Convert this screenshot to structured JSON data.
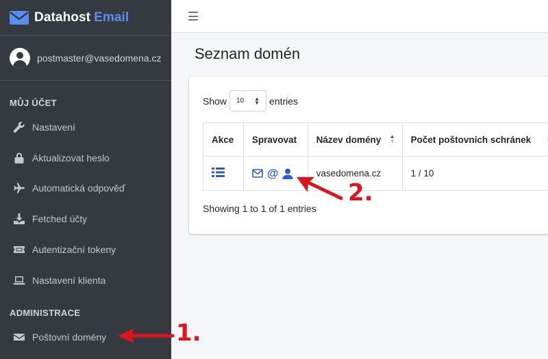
{
  "brand": {
    "name": "Datahost",
    "accent": "Email",
    "logo_icon": "envelope-icon",
    "accent_color": "#5b8def"
  },
  "user": {
    "email": "postmaster@vasedomena.cz",
    "avatar_icon": "user-circle-icon"
  },
  "sidebar": {
    "sections": [
      {
        "header": "MŮJ ÚČET",
        "items": [
          {
            "label": "Nastavení",
            "icon": "wrench-icon"
          },
          {
            "label": "Aktualizovat heslo",
            "icon": "lock-icon"
          },
          {
            "label": "Automatická odpověď",
            "icon": "plane-icon"
          },
          {
            "label": "Fetched účty",
            "icon": "download-icon"
          },
          {
            "label": "Autentizační tokeny",
            "icon": "ticket-icon"
          },
          {
            "label": "Nastavení klienta",
            "icon": "laptop-icon"
          }
        ]
      },
      {
        "header": "ADMINISTRACE",
        "items": [
          {
            "label": "Poštovní domény",
            "icon": "envelope-icon"
          }
        ]
      }
    ]
  },
  "topbar": {
    "menu_icon": "hamburger-icon"
  },
  "page": {
    "title": "Seznam domén"
  },
  "table": {
    "length_prefix": "Show",
    "length_value": "10",
    "length_suffix": "entries",
    "columns": [
      "Akce",
      "Spravovat",
      "Název domény",
      "Počet poštovních schránek"
    ],
    "rows": [
      {
        "actions_icon": "list-icon",
        "manage_icons": [
          "envelope-outline-icon",
          "at-icon",
          "user-icon"
        ],
        "at_symbol": "@",
        "domain": "vasedomena.cz",
        "mailboxes": "1 / 10"
      }
    ],
    "info": "Showing 1 to 1 of 1 entries"
  },
  "annotations": {
    "color": "#e0141c",
    "items": [
      {
        "label": "1.",
        "target": "Poštovní domény"
      },
      {
        "label": "2.",
        "target": "user-icon"
      }
    ]
  }
}
